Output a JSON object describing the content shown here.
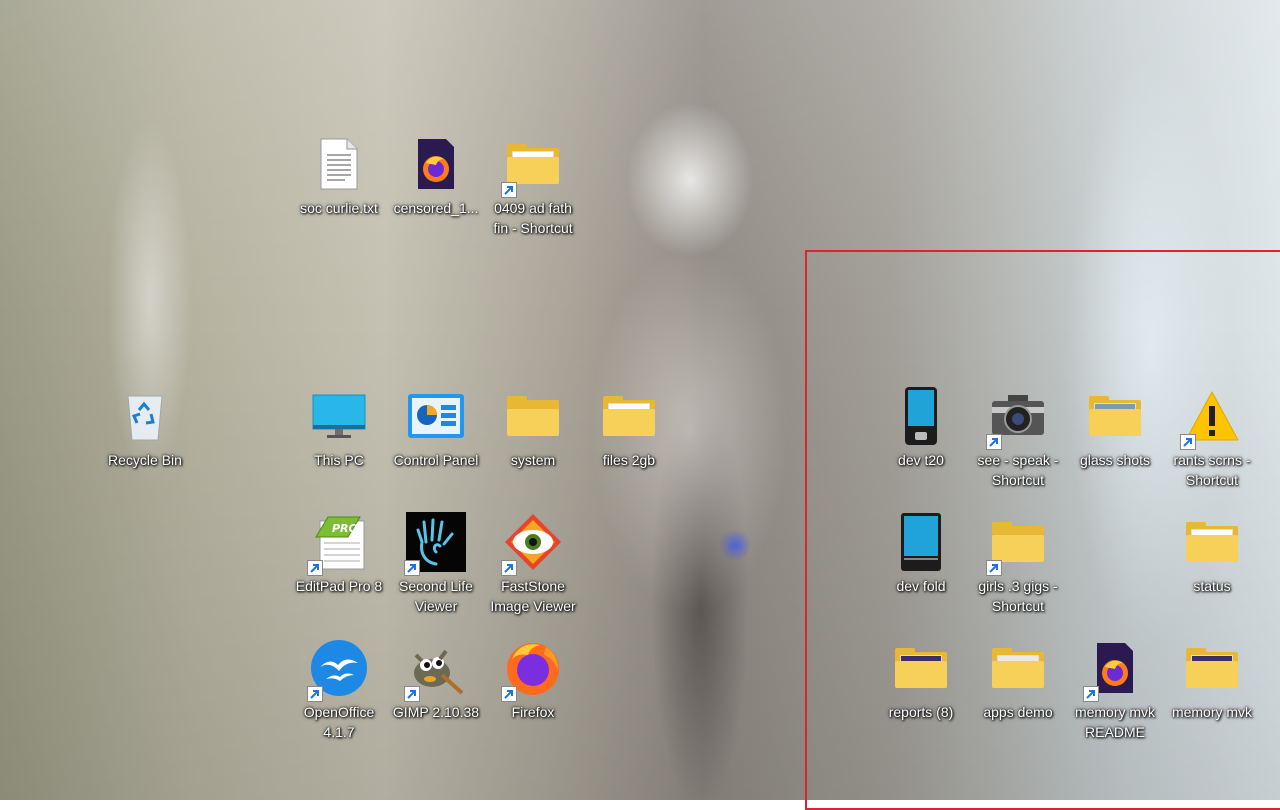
{
  "desktop": {
    "icons": [
      {
        "label": "soc curlie.txt",
        "icon": "text-file-icon",
        "shortcut": false
      },
      {
        "label": "censored_1...",
        "icon": "firefox-document-icon",
        "shortcut": false
      },
      {
        "label": "0409 ad fath fin - Shortcut",
        "icon": "folder-shortcut-icon",
        "shortcut": true
      },
      {
        "label": "Recycle Bin",
        "icon": "recycle-bin-icon",
        "shortcut": false
      },
      {
        "label": "This PC",
        "icon": "monitor-icon",
        "shortcut": false
      },
      {
        "label": "Control Panel",
        "icon": "control-panel-icon",
        "shortcut": false
      },
      {
        "label": "system",
        "icon": "folder-icon",
        "shortcut": false
      },
      {
        "label": "files 2gb",
        "icon": "folder-with-files-icon",
        "shortcut": false
      },
      {
        "label": "EditPad Pro 8",
        "icon": "editpad-pro-icon",
        "shortcut": true
      },
      {
        "label": "Second Life Viewer",
        "icon": "second-life-hand-icon",
        "shortcut": true
      },
      {
        "label": "FastStone Image Viewer",
        "icon": "faststone-eye-icon",
        "shortcut": true
      },
      {
        "label": "OpenOffice 4.1.7",
        "icon": "openoffice-gulls-icon",
        "shortcut": true
      },
      {
        "label": "GIMP 2.10.38",
        "icon": "gimp-wilber-icon",
        "shortcut": true
      },
      {
        "label": "Firefox",
        "icon": "firefox-icon",
        "shortcut": true
      },
      {
        "label": "dev t20",
        "icon": "phone-device-icon",
        "shortcut": false
      },
      {
        "label": "see - speak - Shortcut",
        "icon": "camera-icon",
        "shortcut": true
      },
      {
        "label": "glass shots",
        "icon": "folder-photos-icon",
        "shortcut": false
      },
      {
        "label": "rants scrns - Shortcut",
        "icon": "warning-icon",
        "shortcut": true
      },
      {
        "label": "dev fold",
        "icon": "foldable-device-icon",
        "shortcut": false
      },
      {
        "label": "girls .3 gigs - Shortcut",
        "icon": "folder-icon",
        "shortcut": true
      },
      {
        "label": "status",
        "icon": "folder-with-files-icon",
        "shortcut": false
      },
      {
        "label": "reports (8)",
        "icon": "folder-images-icon",
        "shortcut": false
      },
      {
        "label": "apps demo",
        "icon": "folder-apps-icon",
        "shortcut": false
      },
      {
        "label": "memory mvk README",
        "icon": "firefox-document-icon",
        "shortcut": true
      },
      {
        "label": "memory mvk",
        "icon": "folder-images-icon",
        "shortcut": false
      }
    ]
  },
  "colors": {
    "selection": "#d9252f",
    "folder_yellow": "#f7d05a",
    "label_text": "#ffffff"
  }
}
